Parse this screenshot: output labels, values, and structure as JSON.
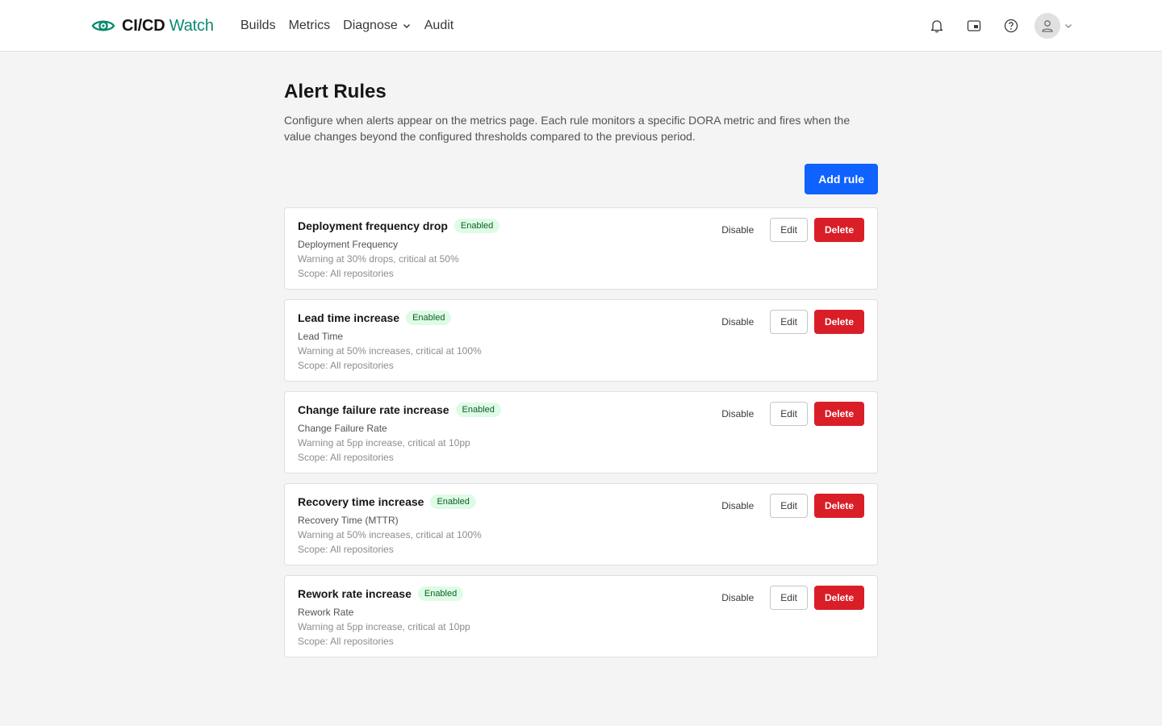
{
  "brand": {
    "name_bold": "CI/CD",
    "name_light": " Watch",
    "accent_color": "#0b8a6f"
  },
  "nav": {
    "items": [
      {
        "label": "Builds"
      },
      {
        "label": "Metrics"
      },
      {
        "label": "Diagnose",
        "icon": "chevron-down-icon"
      },
      {
        "label": "Audit"
      }
    ]
  },
  "header_actions": {
    "icons": [
      "bell-icon",
      "picture-in-picture-icon",
      "help-icon",
      "user-avatar-icon",
      "chevron-down-icon"
    ]
  },
  "page": {
    "title": "Alert Rules",
    "description": "Configure when alerts appear on the metrics page. Each rule monitors a specific DORA metric and fires when the value changes beyond the configured thresholds compared to the previous period.",
    "add_button": "Add rule",
    "accent_color": "#0f62fe",
    "danger_color": "#da1e28"
  },
  "rules": [
    {
      "name": "Deployment frequency drop",
      "status": "Enabled",
      "metric": "Deployment Frequency",
      "threshold": "Warning at 30% drops, critical at 50%",
      "scope": "Scope: All repositories",
      "toggle_label": "Disable",
      "edit_label": "Edit",
      "delete_label": "Delete"
    },
    {
      "name": "Lead time increase",
      "status": "Enabled",
      "metric": "Lead Time",
      "threshold": "Warning at 50% increases, critical at 100%",
      "scope": "Scope: All repositories",
      "toggle_label": "Disable",
      "edit_label": "Edit",
      "delete_label": "Delete"
    },
    {
      "name": "Change failure rate increase",
      "status": "Enabled",
      "metric": "Change Failure Rate",
      "threshold": "Warning at 5pp increase, critical at 10pp",
      "scope": "Scope: All repositories",
      "toggle_label": "Disable",
      "edit_label": "Edit",
      "delete_label": "Delete"
    },
    {
      "name": "Recovery time increase",
      "status": "Enabled",
      "metric": "Recovery Time (MTTR)",
      "threshold": "Warning at 50% increases, critical at 100%",
      "scope": "Scope: All repositories",
      "toggle_label": "Disable",
      "edit_label": "Edit",
      "delete_label": "Delete"
    },
    {
      "name": "Rework rate increase",
      "status": "Enabled",
      "metric": "Rework Rate",
      "threshold": "Warning at 5pp increase, critical at 10pp",
      "scope": "Scope: All repositories",
      "toggle_label": "Disable",
      "edit_label": "Edit",
      "delete_label": "Delete"
    }
  ]
}
